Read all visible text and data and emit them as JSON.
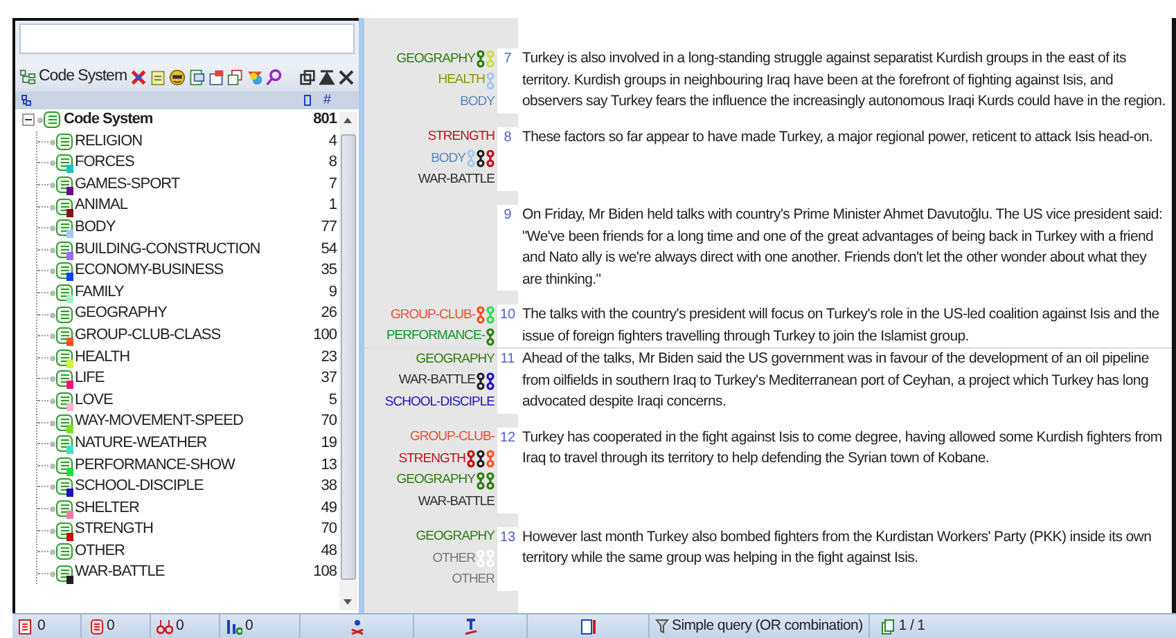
{
  "code_system": {
    "title": "Code System",
    "column_header": "#",
    "root": {
      "label": "Code System",
      "count": "801",
      "expanded": true,
      "children": [
        {
          "label": "RELIGION",
          "count": "4"
        },
        {
          "label": "FORCES",
          "count": "8",
          "color": "#20c0c8"
        },
        {
          "label": "GAMES-SPORT",
          "count": "7",
          "color": "#6a0a8a"
        },
        {
          "label": "ANIMAL",
          "count": "1",
          "color": "#8a1020"
        },
        {
          "label": "BODY",
          "count": "77",
          "color": "#a8c8f0"
        },
        {
          "label": "BUILDING-CONSTRUCTION",
          "count": "54",
          "color": "#9a70f0"
        },
        {
          "label": "ECONOMY-BUSINESS",
          "count": "35",
          "color": "#1040f0"
        },
        {
          "label": "FAMILY",
          "count": "9",
          "color": "#a0f0c8"
        },
        {
          "label": "GEOGRAPHY",
          "count": "26"
        },
        {
          "label": "GROUP-CLUB-CLASS",
          "count": "100",
          "color": "#ff5020"
        },
        {
          "label": "HEALTH",
          "count": "23",
          "color": "#d0f040"
        },
        {
          "label": "LIFE",
          "count": "37",
          "color": "#ff1080"
        },
        {
          "label": "LOVE",
          "count": "5",
          "color": "#ffb0d0"
        },
        {
          "label": "WAY-MOVEMENT-SPEED",
          "count": "70",
          "color": "#80e020"
        },
        {
          "label": "NATURE-WEATHER",
          "count": "19",
          "color": "#40e0c0"
        },
        {
          "label": "PERFORMANCE-SHOW",
          "count": "13",
          "color": "#20e040"
        },
        {
          "label": "SCHOOL-DISCIPLE",
          "count": "38",
          "color": "#2010c0"
        },
        {
          "label": "SHELTER",
          "count": "49",
          "color": "#f080a0"
        },
        {
          "label": "STRENGTH",
          "count": "70",
          "color": "#c01010"
        },
        {
          "label": "OTHER",
          "count": "48"
        },
        {
          "label": "WAR-BATTLE",
          "count": "108",
          "color": "#202020"
        }
      ]
    }
  },
  "document": {
    "paragraphs": [
      {
        "number": "7",
        "text": "Turkey is also involved in a long-standing struggle against separatist Kurdish groups in the east of its territory. Kurdish groups in neighbouring Iraq have been at the forefront of fighting against Isis, and observers say Turkey fears the influence the increasingly autonomous Iraqi Kurds could have in the region.",
        "codes": [
          {
            "label": "GEOGRAPHY",
            "color": "#2e7d10",
            "markers": [
              {
                "color": "#2e7d10"
              },
              {
                "color": "#c8e040"
              }
            ]
          },
          {
            "label": "HEALTH",
            "color": "#8a9a00",
            "markers": [
              {
                "color": "#a8c8f0"
              }
            ]
          },
          {
            "label": "BODY",
            "color": "#5a88c0"
          }
        ]
      },
      {
        "number": "8",
        "text": "These factors so far appear to have made Turkey, a major regional power, reticent to attack Isis head-on.",
        "codes": [
          {
            "label": "STRENGTH",
            "color": "#c01020"
          },
          {
            "label": "BODY",
            "color": "#5a88c0",
            "markers": [
              {
                "color": "#a8c8f0"
              },
              {
                "color": "#202020"
              },
              {
                "color": "#c01020"
              }
            ]
          },
          {
            "label": "WAR-BATTLE",
            "color": "#303030"
          }
        ]
      },
      {
        "number": "9",
        "text": "On Friday, Mr Biden held talks with country's Prime Minister Ahmet Davutoğlu. The US vice president said: \"We've been friends for a long time and one of the great advantages of being back in Turkey with a friend and Nato ally is we're always direct with one another. Friends don't let the other wonder about what they are thinking.\""
      },
      {
        "number": "10",
        "text": "The talks with the country's president will focus on Turkey's role in the US-led coalition against Isis and the issue of foreign fighters travelling through Turkey to join the Islamist group.",
        "codes": [
          {
            "label": "GROUP-CLUB-",
            "color": "#e85030",
            "markers": [
              {
                "color": "#ff5020"
              },
              {
                "color": "#30e050"
              }
            ]
          },
          {
            "label": "PERFORMANCE-",
            "color": "#109a28",
            "markers": [
              {
                "color": "#2e7d10"
              }
            ]
          }
        ]
      },
      {
        "number": "11",
        "text": "Ahead of the talks, Mr Biden said the US government was in favour of the development of an oil pipeline from oilfields in southern Iraq to Turkey's Mediterranean port of Ceyhan, a project which Turkey has long advocated despite Iraqi concerns.",
        "codes": [
          {
            "label": "GEOGRAPHY",
            "color": "#2e7d10"
          },
          {
            "label": "WAR-BATTLE",
            "color": "#303030",
            "markers": [
              {
                "color": "#202020"
              },
              {
                "color": "#2010c0"
              }
            ]
          },
          {
            "label": "SCHOOL-DISCIPLE",
            "color": "#2010c0"
          }
        ]
      },
      {
        "number": "12",
        "text": "Turkey has cooperated in the fight against Isis to come degree, having allowed some Kurdish fighters from Iraq to travel through its territory to help defending the Syrian town of Kobane.",
        "codes": [
          {
            "label": "GROUP-CLUB-",
            "color": "#e85030"
          },
          {
            "label": "STRENGTH",
            "color": "#c01020",
            "markers": [
              {
                "color": "#c01010"
              },
              {
                "color": "#202020"
              },
              {
                "color": "#ff5020"
              }
            ]
          },
          {
            "label": "GEOGRAPHY",
            "color": "#2e7d10",
            "markers": [
              {
                "color": "#2e7d10"
              },
              {
                "color": "#2e7d10"
              }
            ]
          },
          {
            "label": "WAR-BATTLE",
            "color": "#303030"
          }
        ]
      },
      {
        "number": "13",
        "text": "However last month Turkey also bombed fighters from the Kurdistan Workers' Party (PKK) inside its own territory while the same group was helping in the fight against Isis.",
        "codes": [
          {
            "label": "GEOGRAPHY",
            "color": "#2e7d10"
          },
          {
            "label": "OTHER",
            "color": "#7a7a7a",
            "markers": [
              {
                "color": "#ffffff"
              },
              {
                "color": "#ffffff"
              }
            ]
          },
          {
            "label": "OTHER",
            "color": "#7a7a7a"
          }
        ]
      }
    ]
  },
  "status_bar": {
    "counts": [
      "0",
      "0",
      "0",
      "0"
    ],
    "query": "Simple query (OR combination)",
    "pages": "1 / 1"
  }
}
